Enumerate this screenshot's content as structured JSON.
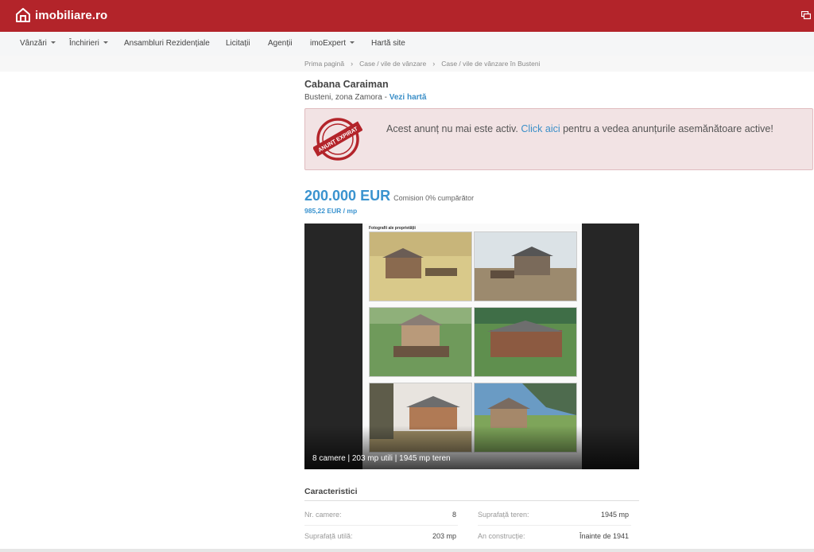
{
  "brand": {
    "name": "imobiliare.ro",
    "color": "#b3242a",
    "accent": "#3a93cf"
  },
  "nav": {
    "items": [
      {
        "label": "Vânzări",
        "dropdown": true
      },
      {
        "label": "Închirieri",
        "dropdown": true
      },
      {
        "label": "Ansambluri Rezidențiale",
        "dropdown": false
      },
      {
        "label": "Licitații",
        "dropdown": false
      },
      {
        "label": "Agenții",
        "dropdown": false
      },
      {
        "label": "imoExpert",
        "dropdown": true
      },
      {
        "label": "Hartă site",
        "dropdown": false
      }
    ]
  },
  "breadcrumb": [
    "Prima pagină",
    "Case / vile de vânzare",
    "Case / vile de vânzare în Busteni"
  ],
  "listing": {
    "title": "Cabana Caraiman",
    "location": "Busteni, zona Zamora",
    "location_sep": " - ",
    "map_link": "Vezi hartă"
  },
  "alert": {
    "stamp_text": "ANUNȚ EXPIRAT",
    "text_before": "Acest anunț nu mai este activ. ",
    "link": "Click aici",
    "text_after": " pentru a vedea anunțurile asemănătoare active!"
  },
  "price": {
    "amount": "200.000 EUR",
    "commission": "Comision 0% cumpărător",
    "per_sqm": "985,22 EUR / mp"
  },
  "gallery": {
    "doc_header": "Fotografii ale proprietății",
    "caption": "8 camere | 203 mp utili | 1945 mp teren"
  },
  "specs": {
    "title": "Caracteristici",
    "rows": [
      {
        "label": "Nr. camere:",
        "value": "8",
        "label2": "Suprafață teren:",
        "value2": "1945 mp"
      },
      {
        "label": "Suprafață utilă:",
        "value": "203 mp",
        "label2": "An construcție:",
        "value2": "Înainte de 1941"
      }
    ]
  }
}
